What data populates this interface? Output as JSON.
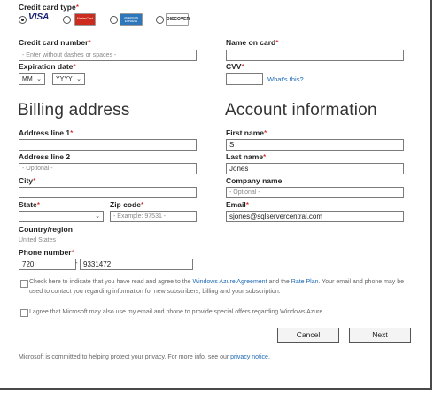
{
  "payment": {
    "card_type_label": "Credit card type",
    "cards": [
      {
        "name": "visa",
        "text": "VISA",
        "selected": true,
        "color": "#1a1f71"
      },
      {
        "name": "mastercard",
        "text": "MasterCard",
        "selected": false,
        "color": "#cc2b1d"
      },
      {
        "name": "amex",
        "text": "AMERICAN EXPRESS",
        "selected": false,
        "color": "#2e77bb"
      },
      {
        "name": "discover",
        "text": "DISCOVER",
        "selected": false,
        "color": "#f58220"
      }
    ],
    "card_number_label": "Credit card number",
    "card_number_placeholder": "- Enter without dashes or spaces -",
    "name_on_card_label": "Name on card",
    "expiration_label": "Expiration date",
    "exp_month": "MM",
    "exp_year": "YYYY",
    "cvv_label": "CVV",
    "whats_this": "What's this?"
  },
  "billing": {
    "heading": "Billing address",
    "address1_label": "Address line 1",
    "address2_label": "Address line 2",
    "address2_placeholder": "- Optional -",
    "city_label": "City",
    "state_label": "State",
    "zip_label": "Zip code",
    "zip_placeholder": "- Example: 97531 -",
    "country_label": "Country/region",
    "country_value": "United States",
    "phone_label": "Phone number",
    "phone_area": "720",
    "phone_number": "9331472"
  },
  "account": {
    "heading": "Account information",
    "first_name_label": "First name",
    "first_name_value": "S",
    "last_name_label": "Last name",
    "last_name_value": "Jones",
    "company_label": "Company name",
    "company_placeholder": "- Optional -",
    "email_label": "Email",
    "email_value": "sjones@sqlservercentral.com"
  },
  "agreement": {
    "text1_a": "Check here to indicate that you have read and agree to the ",
    "text1_link1": "Windows Azure Agreement",
    "text1_b": " and the ",
    "text1_link2": "Rate Plan",
    "text1_c": ". Your email and phone may be used to contact you regarding information for new subscribers, billing and your subscription.",
    "text2": "I agree that Microsoft may also use my email and phone to provide special offers regarding Windows Azure."
  },
  "buttons": {
    "cancel": "Cancel",
    "next": "Next"
  },
  "footer": {
    "text": "Microsoft is committed to helping protect your privacy. For more info, see our ",
    "link": "privacy notice",
    "end": "."
  },
  "colors": {
    "link": "#1d6ab5",
    "required": "#cc0000"
  }
}
